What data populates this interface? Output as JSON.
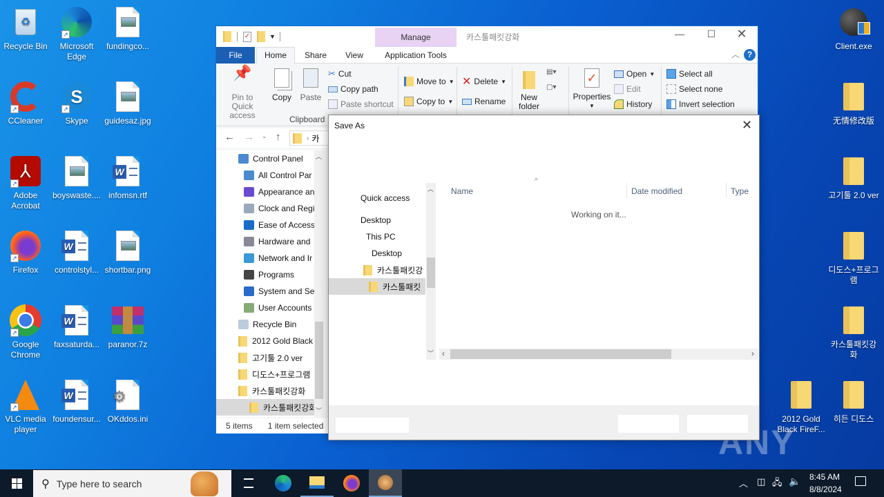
{
  "desktop": {
    "left_icons": [
      {
        "label": "Recycle Bin",
        "icon": "recycle-bin-icon"
      },
      {
        "label": "Microsoft Edge",
        "icon": "edge-icon"
      },
      {
        "label": "fundingco...",
        "icon": "image-file-icon"
      },
      {
        "label": "CCleaner",
        "icon": "ccleaner-icon"
      },
      {
        "label": "Skype",
        "icon": "skype-icon"
      },
      {
        "label": "guidesaz.jpg",
        "icon": "image-file-icon"
      },
      {
        "label": "Adobe Acrobat",
        "icon": "acrobat-icon"
      },
      {
        "label": "boyswaste....",
        "icon": "image-file-icon"
      },
      {
        "label": "infomsn.rtf",
        "icon": "word-file-icon"
      },
      {
        "label": "Firefox",
        "icon": "firefox-icon"
      },
      {
        "label": "controlstyl...",
        "icon": "word-file-icon"
      },
      {
        "label": "shortbar.png",
        "icon": "image-file-icon"
      },
      {
        "label": "Google Chrome",
        "icon": "chrome-icon"
      },
      {
        "label": "faxsaturda...",
        "icon": "word-file-icon"
      },
      {
        "label": "paranor.7z",
        "icon": "winrar-archive-icon"
      },
      {
        "label": "VLC media player",
        "icon": "vlc-icon"
      },
      {
        "label": "foundensur...",
        "icon": "word-file-icon"
      },
      {
        "label": "OKddos.ini",
        "icon": "ini-settings-file-icon"
      }
    ],
    "right_icons": [
      {
        "label": "Client.exe",
        "icon": "exe-bomb-icon"
      },
      {
        "label": "无情修改版",
        "icon": "folder-icon"
      },
      {
        "label": "고기툴 2.0 ver",
        "icon": "folder-icon"
      },
      {
        "label": "디도스+프로그램",
        "icon": "folder-icon"
      },
      {
        "label": "카스툴패킷강화",
        "icon": "folder-icon"
      },
      {
        "label": "2012 Gold Black FireF...",
        "icon": "folder-icon"
      },
      {
        "label": "히든 디도스",
        "icon": "folder-icon"
      }
    ],
    "watermark": "ANY RUN"
  },
  "explorer": {
    "title": "카스툴패킷강화",
    "context_tab_group": "Manage",
    "tabs": [
      "File",
      "Home",
      "Share",
      "View",
      "Application Tools"
    ],
    "active_tab": "Home",
    "ribbon": {
      "pin": "Pin to Quick access",
      "copy": "Copy",
      "paste": "Paste",
      "cut": "Cut",
      "copy_path": "Copy path",
      "paste_shortcut": "Paste shortcut",
      "clipboard_group": "Clipboard",
      "move_to": "Move to",
      "copy_to": "Copy to",
      "delete": "Delete",
      "rename": "Rename",
      "new_folder": "New folder",
      "properties": "Properties",
      "open": "Open",
      "edit": "Edit",
      "history": "History",
      "select_all": "Select all",
      "select_none": "Select none",
      "invert_selection": "Invert selection"
    },
    "address_crumb": "카",
    "nav_tree": [
      {
        "label": "Control Panel",
        "level": 0,
        "icon": "control-panel-icon"
      },
      {
        "label": "All Control Par",
        "level": 1,
        "icon": "control-panel-icon"
      },
      {
        "label": "Appearance an",
        "level": 1,
        "icon": "appearance-icon"
      },
      {
        "label": "Clock and Regi",
        "level": 1,
        "icon": "clock-icon"
      },
      {
        "label": "Ease of Access",
        "level": 1,
        "icon": "ease-of-access-icon"
      },
      {
        "label": "Hardware and",
        "level": 1,
        "icon": "hardware-icon"
      },
      {
        "label": "Network and Ir",
        "level": 1,
        "icon": "network-icon"
      },
      {
        "label": "Programs",
        "level": 1,
        "icon": "programs-icon"
      },
      {
        "label": "System and Se",
        "level": 1,
        "icon": "system-security-icon"
      },
      {
        "label": "User Accounts",
        "level": 1,
        "icon": "user-accounts-icon"
      },
      {
        "label": "Recycle Bin",
        "level": 0,
        "icon": "recycle-bin-icon"
      },
      {
        "label": "2012 Gold Black",
        "level": 0,
        "icon": "folder-icon"
      },
      {
        "label": "고기툴 2.0 ver",
        "level": 0,
        "icon": "folder-icon"
      },
      {
        "label": "디도스+프로그램",
        "level": 0,
        "icon": "folder-icon"
      },
      {
        "label": "카스툴패킷강화",
        "level": 0,
        "icon": "folder-icon"
      },
      {
        "label": "카스툴패킷강화",
        "level": 1,
        "icon": "folder-icon",
        "selected": true
      }
    ],
    "status": {
      "items": "5 items",
      "selected": "1 item selected"
    }
  },
  "save_as": {
    "title": "Save As",
    "nav": [
      {
        "label": "Quick access",
        "level": 0
      },
      {
        "label": "Desktop",
        "level": 0
      },
      {
        "label": "This PC",
        "level": 1
      },
      {
        "label": "Desktop",
        "level": 2
      },
      {
        "label": "카스툴패킷강",
        "level": 3,
        "folder": true
      },
      {
        "label": "카스툴패킷",
        "level": 4,
        "folder": true,
        "selected": true
      }
    ],
    "columns": [
      "Name",
      "Date modified",
      "Type"
    ],
    "status_text": "Working on it..."
  },
  "taskbar": {
    "search_placeholder": "Type here to search",
    "time": "8:45 AM",
    "date": "8/8/2024",
    "pinned": [
      "task-view-icon",
      "edge-icon",
      "file-explorer-icon",
      "firefox-icon",
      "running-app-icon"
    ]
  },
  "colors": {
    "accent": "#1c6fc4",
    "file_tab": "#1a5fb4",
    "manage_tab": "#e8d3f4",
    "taskbar": "#0c1a2a"
  }
}
